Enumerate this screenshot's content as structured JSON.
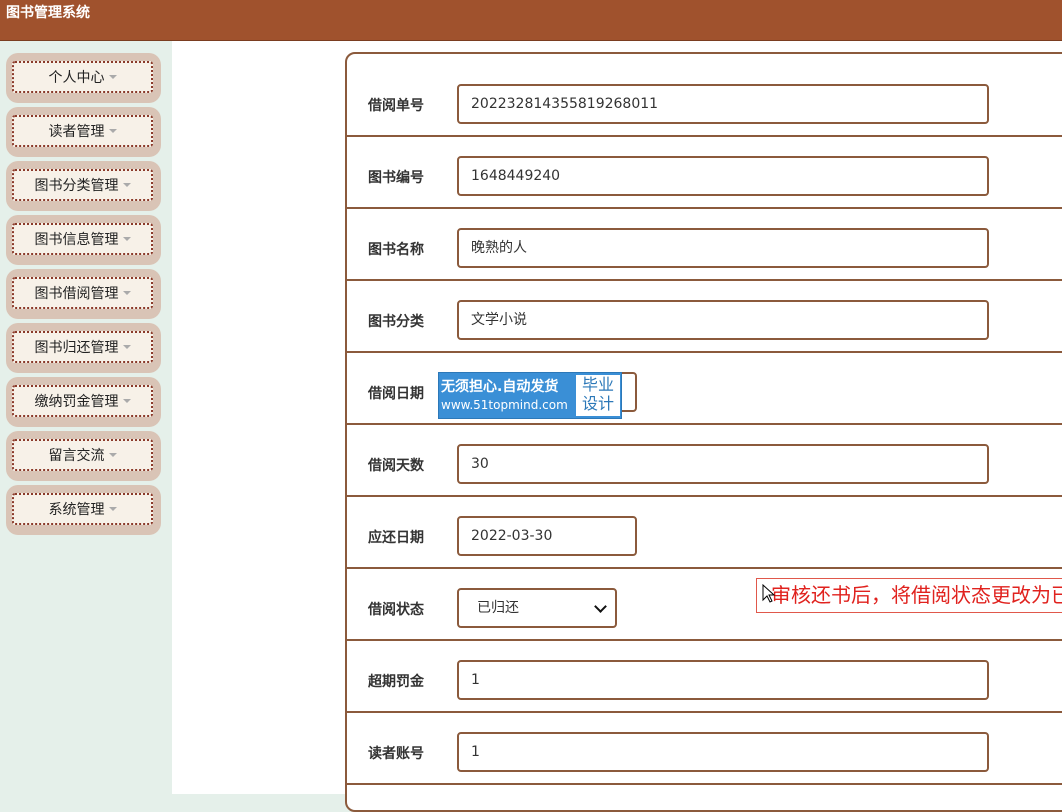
{
  "app": {
    "title": "图书管理系统"
  },
  "sidebar": {
    "items": [
      {
        "label": "个人中心"
      },
      {
        "label": "读者管理"
      },
      {
        "label": "图书分类管理"
      },
      {
        "label": "图书信息管理"
      },
      {
        "label": "图书借阅管理"
      },
      {
        "label": "图书归还管理"
      },
      {
        "label": "缴纳罚金管理"
      },
      {
        "label": "留言交流"
      },
      {
        "label": "系统管理"
      }
    ]
  },
  "form": {
    "fields": [
      {
        "label": "借阅单号",
        "value": "20223281435581926801​1"
      },
      {
        "label": "图书编号",
        "value": "1648449240"
      },
      {
        "label": "图书名称",
        "value": "晚熟的人"
      },
      {
        "label": "图书分类",
        "value": "文学小说"
      },
      {
        "label": "借阅日期",
        "value": ""
      },
      {
        "label": "借阅天数",
        "value": "30"
      },
      {
        "label": "应还日期",
        "value": "2022-03-30"
      },
      {
        "label": "借阅状态",
        "value": "已归还"
      },
      {
        "label": "超期罚金",
        "value": "1"
      },
      {
        "label": "读者账号",
        "value": "1"
      }
    ]
  },
  "watermark": {
    "line1": "无须担心.自动发货",
    "line2": "www.51topmind.com",
    "badge_line1": "毕业",
    "badge_line2": "设计"
  },
  "hint": {
    "text": "审核还书后，将借阅状态更改为已"
  },
  "colors": {
    "topbar": "#a0522d",
    "accent_border": "#8b5a3c",
    "sidebar_bg": "#e5f0ea"
  }
}
